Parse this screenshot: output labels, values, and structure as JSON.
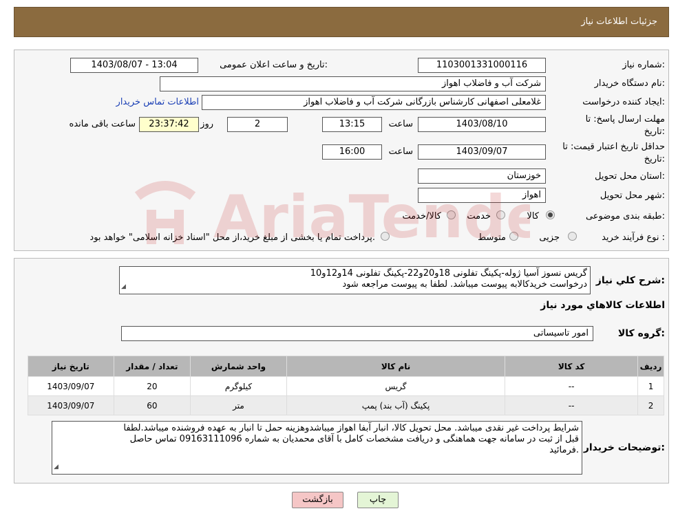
{
  "header": {
    "title": "جزئیات اطلاعات نیاز"
  },
  "form": {
    "need_number": {
      "label": "شماره نیاز:",
      "value": "1103001331000116"
    },
    "announce": {
      "label": "تاریخ و ساعت اعلان عمومی:",
      "value": "1403/08/07 - 13:04"
    },
    "buyer_org": {
      "label": "نام دستگاه خریدار:",
      "value": "شرکت آب و فاضلاب اهواز"
    },
    "creator": {
      "label": "ایجاد کننده درخواست:",
      "value": "غلامعلی اصفهانی کارشناس بازرگانی شرکت آب و فاضلاب اهواز",
      "link": "اطلاعات تماس خریدار"
    },
    "deadline": {
      "label_line1": "مهلت ارسال پاسخ: تا",
      "label_line2": "تاریخ:",
      "date": "1403/08/10",
      "time_label": "ساعت",
      "time": "13:15",
      "days": "2",
      "days_label": "روز و",
      "remaining": "23:37:42",
      "remaining_label": "ساعت باقی مانده"
    },
    "price_validity": {
      "label_line1": "حداقل تاریخ اعتبار قیمت: تا",
      "label_line2": "تاریخ:",
      "date": "1403/09/07",
      "time_label": "ساعت",
      "time": "16:00"
    },
    "province": {
      "label": "استان محل تحویل:",
      "value": "خوزستان"
    },
    "city": {
      "label": "شهر محل تحویل:",
      "value": "اهواز"
    },
    "category": {
      "label": "طبقه بندی موضوعی:",
      "options": [
        "کالا",
        "خدمت",
        "کالا/خدمت"
      ],
      "selected": "کالا"
    },
    "process": {
      "label": "نوع فرآیند خرید :",
      "options": [
        "جزیی",
        "متوسط"
      ],
      "note": "پرداخت تمام یا بخشی از مبلغ خرید،از محل \"اسناد خزانه اسلامی\" خواهد بود."
    }
  },
  "general": {
    "label": "شرح کلي نياز:",
    "line1": "گریس نسوز آسیا ژوله-پکینگ تفلونی 18و20و22-پکینگ تفلونی 14و12و10",
    "line2": "درخواست خریدکالابه پیوست میباشد. لطفا به پیوست مراجعه شود"
  },
  "goods_section": {
    "title": "اطلاعات کالاهاي مورد نياز"
  },
  "goods_group": {
    "label": "گروه کالا:",
    "value": "امور تاسیساتی"
  },
  "table": {
    "columns": [
      "رديف",
      "کد کالا",
      "نام کالا",
      "واحد شمارش",
      "تعداد / مقدار",
      "تاريخ نياز"
    ],
    "rows": [
      [
        "1",
        "--",
        "گریس",
        "کیلوگرم",
        "20",
        "1403/09/07"
      ],
      [
        "2",
        "--",
        "پکینگ (آب بند) پمپ",
        "متر",
        "60",
        "1403/09/07"
      ]
    ]
  },
  "buyer_notes": {
    "label": "توضیحات خریدار:",
    "line1": "شرایط پرداخت غیر نقدی میباشد. محل تحویل کالا، انبار آبفا اهواز میباشدوهزینه حمل تا انبار به عهده فروشنده میباشد.لطفا",
    "line2": "قبل از ثبت در سامانه جهت هماهنگی و دریافت مشخصات کامل با آقای  محمدیان به شماره 09163111096 تماس حاصل",
    "line3": "فرمائید."
  },
  "buttons": {
    "print": "چاپ",
    "back": "بازگشت"
  },
  "watermark": {
    "text": "AriaTender.neT"
  }
}
